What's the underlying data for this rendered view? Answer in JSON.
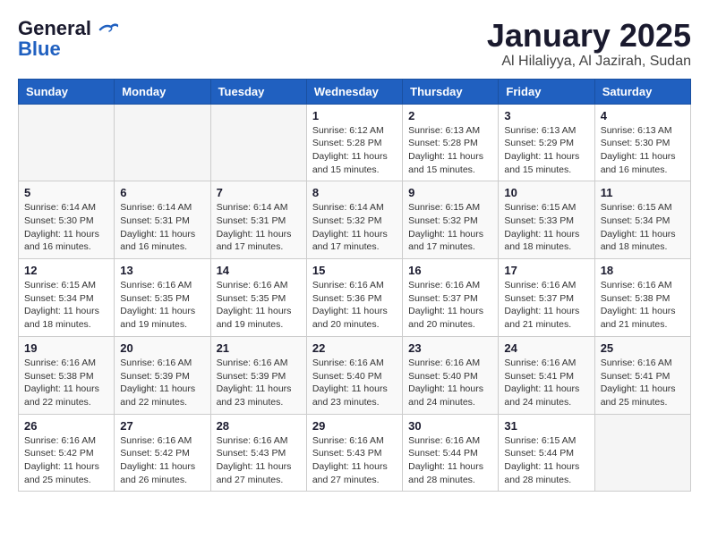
{
  "header": {
    "logo_line1": "General",
    "logo_line2": "Blue",
    "title": "January 2025",
    "subtitle": "Al Hilaliyya, Al Jazirah, Sudan"
  },
  "weekdays": [
    "Sunday",
    "Monday",
    "Tuesday",
    "Wednesday",
    "Thursday",
    "Friday",
    "Saturday"
  ],
  "weeks": [
    [
      {
        "day": "",
        "info": ""
      },
      {
        "day": "",
        "info": ""
      },
      {
        "day": "",
        "info": ""
      },
      {
        "day": "1",
        "info": "Sunrise: 6:12 AM\nSunset: 5:28 PM\nDaylight: 11 hours and 15 minutes."
      },
      {
        "day": "2",
        "info": "Sunrise: 6:13 AM\nSunset: 5:28 PM\nDaylight: 11 hours and 15 minutes."
      },
      {
        "day": "3",
        "info": "Sunrise: 6:13 AM\nSunset: 5:29 PM\nDaylight: 11 hours and 15 minutes."
      },
      {
        "day": "4",
        "info": "Sunrise: 6:13 AM\nSunset: 5:30 PM\nDaylight: 11 hours and 16 minutes."
      }
    ],
    [
      {
        "day": "5",
        "info": "Sunrise: 6:14 AM\nSunset: 5:30 PM\nDaylight: 11 hours and 16 minutes."
      },
      {
        "day": "6",
        "info": "Sunrise: 6:14 AM\nSunset: 5:31 PM\nDaylight: 11 hours and 16 minutes."
      },
      {
        "day": "7",
        "info": "Sunrise: 6:14 AM\nSunset: 5:31 PM\nDaylight: 11 hours and 17 minutes."
      },
      {
        "day": "8",
        "info": "Sunrise: 6:14 AM\nSunset: 5:32 PM\nDaylight: 11 hours and 17 minutes."
      },
      {
        "day": "9",
        "info": "Sunrise: 6:15 AM\nSunset: 5:32 PM\nDaylight: 11 hours and 17 minutes."
      },
      {
        "day": "10",
        "info": "Sunrise: 6:15 AM\nSunset: 5:33 PM\nDaylight: 11 hours and 18 minutes."
      },
      {
        "day": "11",
        "info": "Sunrise: 6:15 AM\nSunset: 5:34 PM\nDaylight: 11 hours and 18 minutes."
      }
    ],
    [
      {
        "day": "12",
        "info": "Sunrise: 6:15 AM\nSunset: 5:34 PM\nDaylight: 11 hours and 18 minutes."
      },
      {
        "day": "13",
        "info": "Sunrise: 6:16 AM\nSunset: 5:35 PM\nDaylight: 11 hours and 19 minutes."
      },
      {
        "day": "14",
        "info": "Sunrise: 6:16 AM\nSunset: 5:35 PM\nDaylight: 11 hours and 19 minutes."
      },
      {
        "day": "15",
        "info": "Sunrise: 6:16 AM\nSunset: 5:36 PM\nDaylight: 11 hours and 20 minutes."
      },
      {
        "day": "16",
        "info": "Sunrise: 6:16 AM\nSunset: 5:37 PM\nDaylight: 11 hours and 20 minutes."
      },
      {
        "day": "17",
        "info": "Sunrise: 6:16 AM\nSunset: 5:37 PM\nDaylight: 11 hours and 21 minutes."
      },
      {
        "day": "18",
        "info": "Sunrise: 6:16 AM\nSunset: 5:38 PM\nDaylight: 11 hours and 21 minutes."
      }
    ],
    [
      {
        "day": "19",
        "info": "Sunrise: 6:16 AM\nSunset: 5:38 PM\nDaylight: 11 hours and 22 minutes."
      },
      {
        "day": "20",
        "info": "Sunrise: 6:16 AM\nSunset: 5:39 PM\nDaylight: 11 hours and 22 minutes."
      },
      {
        "day": "21",
        "info": "Sunrise: 6:16 AM\nSunset: 5:39 PM\nDaylight: 11 hours and 23 minutes."
      },
      {
        "day": "22",
        "info": "Sunrise: 6:16 AM\nSunset: 5:40 PM\nDaylight: 11 hours and 23 minutes."
      },
      {
        "day": "23",
        "info": "Sunrise: 6:16 AM\nSunset: 5:40 PM\nDaylight: 11 hours and 24 minutes."
      },
      {
        "day": "24",
        "info": "Sunrise: 6:16 AM\nSunset: 5:41 PM\nDaylight: 11 hours and 24 minutes."
      },
      {
        "day": "25",
        "info": "Sunrise: 6:16 AM\nSunset: 5:41 PM\nDaylight: 11 hours and 25 minutes."
      }
    ],
    [
      {
        "day": "26",
        "info": "Sunrise: 6:16 AM\nSunset: 5:42 PM\nDaylight: 11 hours and 25 minutes."
      },
      {
        "day": "27",
        "info": "Sunrise: 6:16 AM\nSunset: 5:42 PM\nDaylight: 11 hours and 26 minutes."
      },
      {
        "day": "28",
        "info": "Sunrise: 6:16 AM\nSunset: 5:43 PM\nDaylight: 11 hours and 27 minutes."
      },
      {
        "day": "29",
        "info": "Sunrise: 6:16 AM\nSunset: 5:43 PM\nDaylight: 11 hours and 27 minutes."
      },
      {
        "day": "30",
        "info": "Sunrise: 6:16 AM\nSunset: 5:44 PM\nDaylight: 11 hours and 28 minutes."
      },
      {
        "day": "31",
        "info": "Sunrise: 6:15 AM\nSunset: 5:44 PM\nDaylight: 11 hours and 28 minutes."
      },
      {
        "day": "",
        "info": ""
      }
    ]
  ]
}
